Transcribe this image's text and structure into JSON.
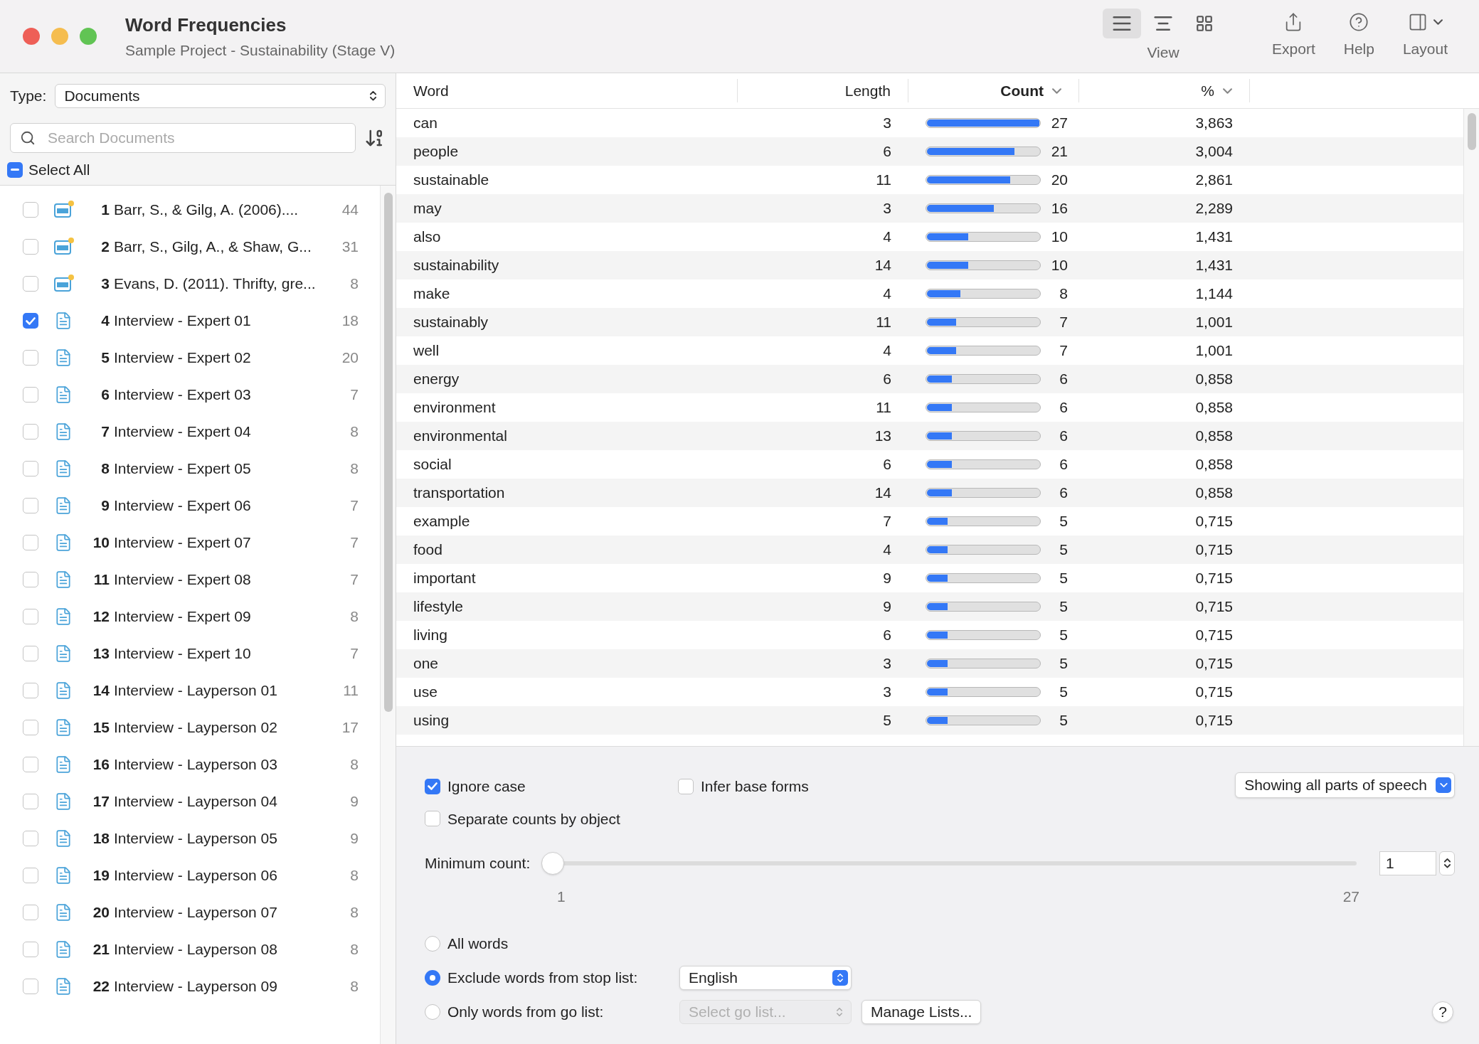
{
  "window": {
    "title": "Word Frequencies",
    "subtitle": "Sample Project - Sustainability (Stage V)"
  },
  "toolbar": {
    "view_modes": [
      {
        "selected": true
      },
      {
        "selected": false
      },
      {
        "selected": false
      }
    ],
    "view_label": "View",
    "buttons": [
      {
        "label": "Export"
      },
      {
        "label": "Help"
      },
      {
        "label": "Layout"
      }
    ]
  },
  "sidebar": {
    "type_label": "Type:",
    "type_value": "Documents",
    "search": {
      "placeholder": "Search Documents"
    },
    "select_all": {
      "label": "Select All",
      "indeterminate": true
    },
    "items": [
      {
        "number": "1",
        "title": "Barr, S., & Gilg, A. (2006)....",
        "count": "44",
        "kind": "pdf",
        "checked": false
      },
      {
        "number": "2",
        "title": "Barr, S., Gilg, A., & Shaw, G...",
        "count": "31",
        "kind": "pdf",
        "checked": false
      },
      {
        "number": "3",
        "title": "Evans, D. (2011). Thrifty, gre...",
        "count": "8",
        "kind": "pdf",
        "checked": false
      },
      {
        "number": "4",
        "title": "Interview - Expert 01",
        "count": "18",
        "kind": "text",
        "checked": true
      },
      {
        "number": "5",
        "title": "Interview - Expert 02",
        "count": "20",
        "kind": "text",
        "checked": false
      },
      {
        "number": "6",
        "title": "Interview - Expert 03",
        "count": "7",
        "kind": "text",
        "checked": false
      },
      {
        "number": "7",
        "title": "Interview - Expert 04",
        "count": "8",
        "kind": "text",
        "checked": false
      },
      {
        "number": "8",
        "title": "Interview - Expert 05",
        "count": "8",
        "kind": "text",
        "checked": false
      },
      {
        "number": "9",
        "title": "Interview - Expert 06",
        "count": "7",
        "kind": "text",
        "checked": false
      },
      {
        "number": "10",
        "title": "Interview - Expert 07",
        "count": "7",
        "kind": "text",
        "checked": false
      },
      {
        "number": "11",
        "title": "Interview - Expert 08",
        "count": "7",
        "kind": "text",
        "checked": false
      },
      {
        "number": "12",
        "title": "Interview - Expert 09",
        "count": "8",
        "kind": "text",
        "checked": false
      },
      {
        "number": "13",
        "title": "Interview - Expert 10",
        "count": "7",
        "kind": "text",
        "checked": false
      },
      {
        "number": "14",
        "title": "Interview - Layperson 01",
        "count": "11",
        "kind": "text",
        "checked": false
      },
      {
        "number": "15",
        "title": "Interview - Layperson 02",
        "count": "17",
        "kind": "text",
        "checked": false
      },
      {
        "number": "16",
        "title": "Interview - Layperson 03",
        "count": "8",
        "kind": "text",
        "checked": false
      },
      {
        "number": "17",
        "title": "Interview - Layperson 04",
        "count": "9",
        "kind": "text",
        "checked": false
      },
      {
        "number": "18",
        "title": "Interview - Layperson 05",
        "count": "9",
        "kind": "text",
        "checked": false
      },
      {
        "number": "19",
        "title": "Interview - Layperson 06",
        "count": "8",
        "kind": "text",
        "checked": false
      },
      {
        "number": "20",
        "title": "Interview - Layperson 07",
        "count": "8",
        "kind": "text",
        "checked": false
      },
      {
        "number": "21",
        "title": "Interview - Layperson 08",
        "count": "8",
        "kind": "text",
        "checked": false
      },
      {
        "number": "22",
        "title": "Interview - Layperson 09",
        "count": "8",
        "kind": "text",
        "checked": false
      }
    ]
  },
  "table": {
    "columns": [
      {
        "label": "Word",
        "sorted": false
      },
      {
        "label": "Length",
        "sorted": false
      },
      {
        "label": "Count",
        "sorted": true
      },
      {
        "label": "%",
        "sorted": false
      }
    ],
    "rows": [
      {
        "word": "can",
        "length": "3",
        "level": 1,
        "count": "27",
        "percent": "3,863"
      },
      {
        "word": "people",
        "length": "6",
        "level": 0.778,
        "count": "21",
        "percent": "3,004"
      },
      {
        "word": "sustainable",
        "length": "11",
        "level": 0.741,
        "count": "20",
        "percent": "2,861"
      },
      {
        "word": "may",
        "length": "3",
        "level": 0.593,
        "count": "16",
        "percent": "2,289"
      },
      {
        "word": "also",
        "length": "4",
        "level": 0.37,
        "count": "10",
        "percent": "1,431"
      },
      {
        "word": "sustainability",
        "length": "14",
        "level": 0.37,
        "count": "10",
        "percent": "1,431"
      },
      {
        "word": "make",
        "length": "4",
        "level": 0.296,
        "count": "8",
        "percent": "1,144"
      },
      {
        "word": "sustainably",
        "length": "11",
        "level": 0.259,
        "count": "7",
        "percent": "1,001"
      },
      {
        "word": "well",
        "length": "4",
        "level": 0.259,
        "count": "7",
        "percent": "1,001"
      },
      {
        "word": "energy",
        "length": "6",
        "level": 0.222,
        "count": "6",
        "percent": "0,858"
      },
      {
        "word": "environment",
        "length": "11",
        "level": 0.222,
        "count": "6",
        "percent": "0,858"
      },
      {
        "word": "environmental",
        "length": "13",
        "level": 0.222,
        "count": "6",
        "percent": "0,858"
      },
      {
        "word": "social",
        "length": "6",
        "level": 0.222,
        "count": "6",
        "percent": "0,858"
      },
      {
        "word": "transportation",
        "length": "14",
        "level": 0.222,
        "count": "6",
        "percent": "0,858"
      },
      {
        "word": "example",
        "length": "7",
        "level": 0.185,
        "count": "5",
        "percent": "0,715"
      },
      {
        "word": "food",
        "length": "4",
        "level": 0.185,
        "count": "5",
        "percent": "0,715"
      },
      {
        "word": "important",
        "length": "9",
        "level": 0.185,
        "count": "5",
        "percent": "0,715"
      },
      {
        "word": "lifestyle",
        "length": "9",
        "level": 0.185,
        "count": "5",
        "percent": "0,715"
      },
      {
        "word": "living",
        "length": "6",
        "level": 0.185,
        "count": "5",
        "percent": "0,715"
      },
      {
        "word": "one",
        "length": "3",
        "level": 0.185,
        "count": "5",
        "percent": "0,715"
      },
      {
        "word": "use",
        "length": "3",
        "level": 0.185,
        "count": "5",
        "percent": "0,715"
      },
      {
        "word": "using",
        "length": "5",
        "level": 0.185,
        "count": "5",
        "percent": "0,715"
      }
    ]
  },
  "options": {
    "checkboxes": [
      {
        "label": "Ignore case",
        "checked": true
      },
      {
        "label": "Infer base forms",
        "checked": false
      },
      {
        "label": "Separate counts by object",
        "checked": false
      }
    ],
    "parts_of_speech": "Showing all parts of speech",
    "minimum_count": {
      "label": "Minimum count:",
      "level": 0,
      "min_label": "1",
      "max_label": "27",
      "value": "1"
    },
    "word_filters": [
      {
        "label": "All words",
        "selected": false
      },
      {
        "label": "Exclude words from stop list:",
        "selected": true,
        "dropdown": "English",
        "disabled": false
      },
      {
        "label": "Only words from go list:",
        "selected": false,
        "placeholder": "Select go list...",
        "disabled": true
      }
    ],
    "manage_button": "Manage Lists...",
    "help": "?"
  }
}
